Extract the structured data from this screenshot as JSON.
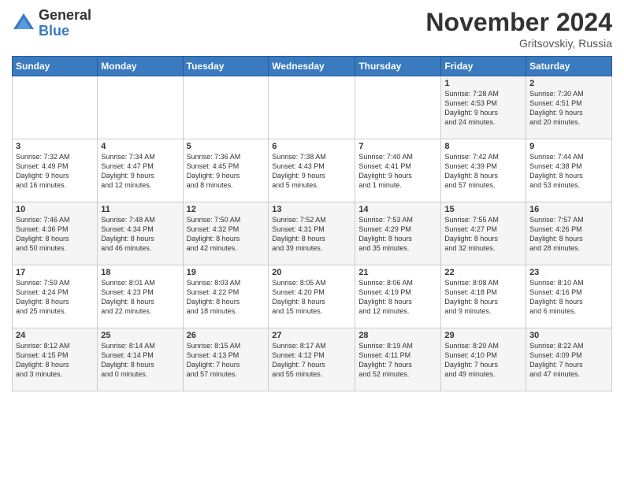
{
  "logo": {
    "general": "General",
    "blue": "Blue"
  },
  "header": {
    "month": "November 2024",
    "location": "Gritsovskiy, Russia"
  },
  "days_of_week": [
    "Sunday",
    "Monday",
    "Tuesday",
    "Wednesday",
    "Thursday",
    "Friday",
    "Saturday"
  ],
  "weeks": [
    [
      {
        "day": "",
        "info": ""
      },
      {
        "day": "",
        "info": ""
      },
      {
        "day": "",
        "info": ""
      },
      {
        "day": "",
        "info": ""
      },
      {
        "day": "",
        "info": ""
      },
      {
        "day": "1",
        "info": "Sunrise: 7:28 AM\nSunset: 4:53 PM\nDaylight: 9 hours\nand 24 minutes."
      },
      {
        "day": "2",
        "info": "Sunrise: 7:30 AM\nSunset: 4:51 PM\nDaylight: 9 hours\nand 20 minutes."
      }
    ],
    [
      {
        "day": "3",
        "info": "Sunrise: 7:32 AM\nSunset: 4:49 PM\nDaylight: 9 hours\nand 16 minutes."
      },
      {
        "day": "4",
        "info": "Sunrise: 7:34 AM\nSunset: 4:47 PM\nDaylight: 9 hours\nand 12 minutes."
      },
      {
        "day": "5",
        "info": "Sunrise: 7:36 AM\nSunset: 4:45 PM\nDaylight: 9 hours\nand 8 minutes."
      },
      {
        "day": "6",
        "info": "Sunrise: 7:38 AM\nSunset: 4:43 PM\nDaylight: 9 hours\nand 5 minutes."
      },
      {
        "day": "7",
        "info": "Sunrise: 7:40 AM\nSunset: 4:41 PM\nDaylight: 9 hours\nand 1 minute."
      },
      {
        "day": "8",
        "info": "Sunrise: 7:42 AM\nSunset: 4:39 PM\nDaylight: 8 hours\nand 57 minutes."
      },
      {
        "day": "9",
        "info": "Sunrise: 7:44 AM\nSunset: 4:38 PM\nDaylight: 8 hours\nand 53 minutes."
      }
    ],
    [
      {
        "day": "10",
        "info": "Sunrise: 7:46 AM\nSunset: 4:36 PM\nDaylight: 8 hours\nand 50 minutes."
      },
      {
        "day": "11",
        "info": "Sunrise: 7:48 AM\nSunset: 4:34 PM\nDaylight: 8 hours\nand 46 minutes."
      },
      {
        "day": "12",
        "info": "Sunrise: 7:50 AM\nSunset: 4:32 PM\nDaylight: 8 hours\nand 42 minutes."
      },
      {
        "day": "13",
        "info": "Sunrise: 7:52 AM\nSunset: 4:31 PM\nDaylight: 8 hours\nand 39 minutes."
      },
      {
        "day": "14",
        "info": "Sunrise: 7:53 AM\nSunset: 4:29 PM\nDaylight: 8 hours\nand 35 minutes."
      },
      {
        "day": "15",
        "info": "Sunrise: 7:55 AM\nSunset: 4:27 PM\nDaylight: 8 hours\nand 32 minutes."
      },
      {
        "day": "16",
        "info": "Sunrise: 7:57 AM\nSunset: 4:26 PM\nDaylight: 8 hours\nand 28 minutes."
      }
    ],
    [
      {
        "day": "17",
        "info": "Sunrise: 7:59 AM\nSunset: 4:24 PM\nDaylight: 8 hours\nand 25 minutes."
      },
      {
        "day": "18",
        "info": "Sunrise: 8:01 AM\nSunset: 4:23 PM\nDaylight: 8 hours\nand 22 minutes."
      },
      {
        "day": "19",
        "info": "Sunrise: 8:03 AM\nSunset: 4:22 PM\nDaylight: 8 hours\nand 18 minutes."
      },
      {
        "day": "20",
        "info": "Sunrise: 8:05 AM\nSunset: 4:20 PM\nDaylight: 8 hours\nand 15 minutes."
      },
      {
        "day": "21",
        "info": "Sunrise: 8:06 AM\nSunset: 4:19 PM\nDaylight: 8 hours\nand 12 minutes."
      },
      {
        "day": "22",
        "info": "Sunrise: 8:08 AM\nSunset: 4:18 PM\nDaylight: 8 hours\nand 9 minutes."
      },
      {
        "day": "23",
        "info": "Sunrise: 8:10 AM\nSunset: 4:16 PM\nDaylight: 8 hours\nand 6 minutes."
      }
    ],
    [
      {
        "day": "24",
        "info": "Sunrise: 8:12 AM\nSunset: 4:15 PM\nDaylight: 8 hours\nand 3 minutes."
      },
      {
        "day": "25",
        "info": "Sunrise: 8:14 AM\nSunset: 4:14 PM\nDaylight: 8 hours\nand 0 minutes."
      },
      {
        "day": "26",
        "info": "Sunrise: 8:15 AM\nSunset: 4:13 PM\nDaylight: 7 hours\nand 57 minutes."
      },
      {
        "day": "27",
        "info": "Sunrise: 8:17 AM\nSunset: 4:12 PM\nDaylight: 7 hours\nand 55 minutes."
      },
      {
        "day": "28",
        "info": "Sunrise: 8:19 AM\nSunset: 4:11 PM\nDaylight: 7 hours\nand 52 minutes."
      },
      {
        "day": "29",
        "info": "Sunrise: 8:20 AM\nSunset: 4:10 PM\nDaylight: 7 hours\nand 49 minutes."
      },
      {
        "day": "30",
        "info": "Sunrise: 8:22 AM\nSunset: 4:09 PM\nDaylight: 7 hours\nand 47 minutes."
      }
    ]
  ]
}
